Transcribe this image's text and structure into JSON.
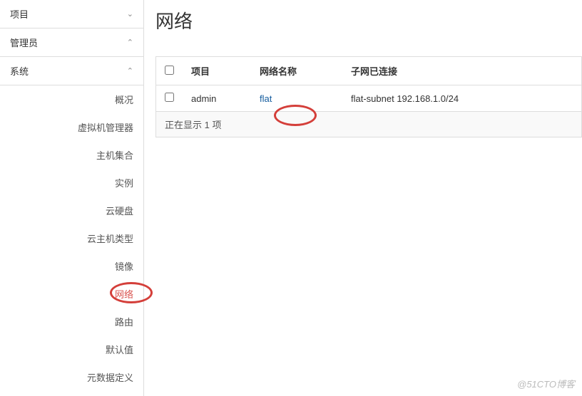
{
  "sidebar": {
    "sections": [
      {
        "label": "项目",
        "expanded": false
      },
      {
        "label": "管理员",
        "expanded": true
      },
      {
        "label": "系统",
        "expanded": true
      }
    ],
    "systemItems": [
      {
        "label": "概况",
        "active": false
      },
      {
        "label": "虚拟机管理器",
        "active": false
      },
      {
        "label": "主机集合",
        "active": false
      },
      {
        "label": "实例",
        "active": false
      },
      {
        "label": "云硬盘",
        "active": false
      },
      {
        "label": "云主机类型",
        "active": false
      },
      {
        "label": "镜像",
        "active": false
      },
      {
        "label": "网络",
        "active": true
      },
      {
        "label": "路由",
        "active": false
      },
      {
        "label": "默认值",
        "active": false
      },
      {
        "label": "元数据定义",
        "active": false
      }
    ]
  },
  "page": {
    "title": "网络"
  },
  "table": {
    "headers": {
      "project": "项目",
      "name": "网络名称",
      "subnets": "子网已连接"
    },
    "rows": [
      {
        "project": "admin",
        "name": "flat",
        "subnets": "flat-subnet 192.168.1.0/24"
      }
    ],
    "footer": "正在显示 1 项"
  },
  "watermark": "@51CTO博客"
}
